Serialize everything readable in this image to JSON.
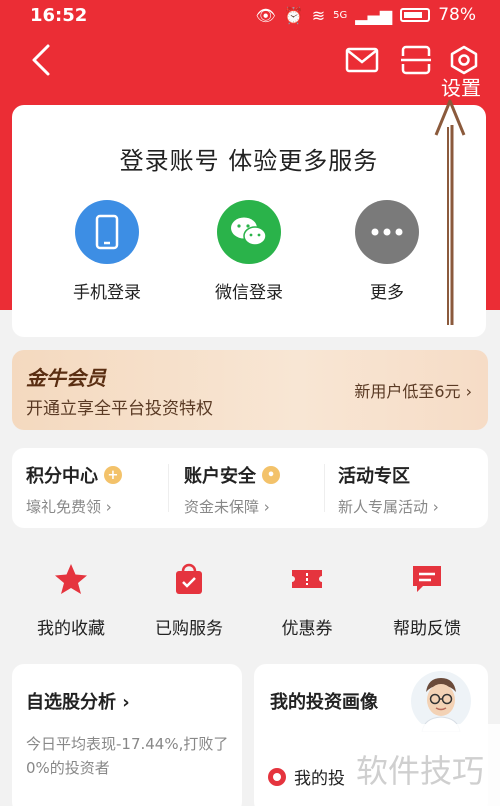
{
  "status_bar": {
    "time": "16:52",
    "network": "5G",
    "battery": "78%"
  },
  "header": {
    "settings_label": "设置"
  },
  "login": {
    "title": "登录账号 体验更多服务",
    "options": [
      "手机登录",
      "微信登录",
      "更多"
    ]
  },
  "member": {
    "title": "金牛会员",
    "subtitle": "开通立享全平台投资特权",
    "cta": "新用户低至6元 ›"
  },
  "cells": [
    {
      "title": "积分中心",
      "sub": "壕礼免费领 ›"
    },
    {
      "title": "账户安全",
      "sub": "资金未保障 ›"
    },
    {
      "title": "活动专区",
      "sub": "新人专属活动 ›"
    }
  ],
  "quick_actions": [
    "我的收藏",
    "已购服务",
    "优惠券",
    "帮助反馈"
  ],
  "stock_card": {
    "title": "自选股分析  ›",
    "desc": "今日平均表现-17.44%,打败了0%的投资者"
  },
  "profile_card": {
    "title": "我的投资画像",
    "row": "我的投"
  },
  "watermark": "软件技巧",
  "colors": {
    "brand_red": "#eb2d35",
    "annotation": "#8b5a3c"
  }
}
